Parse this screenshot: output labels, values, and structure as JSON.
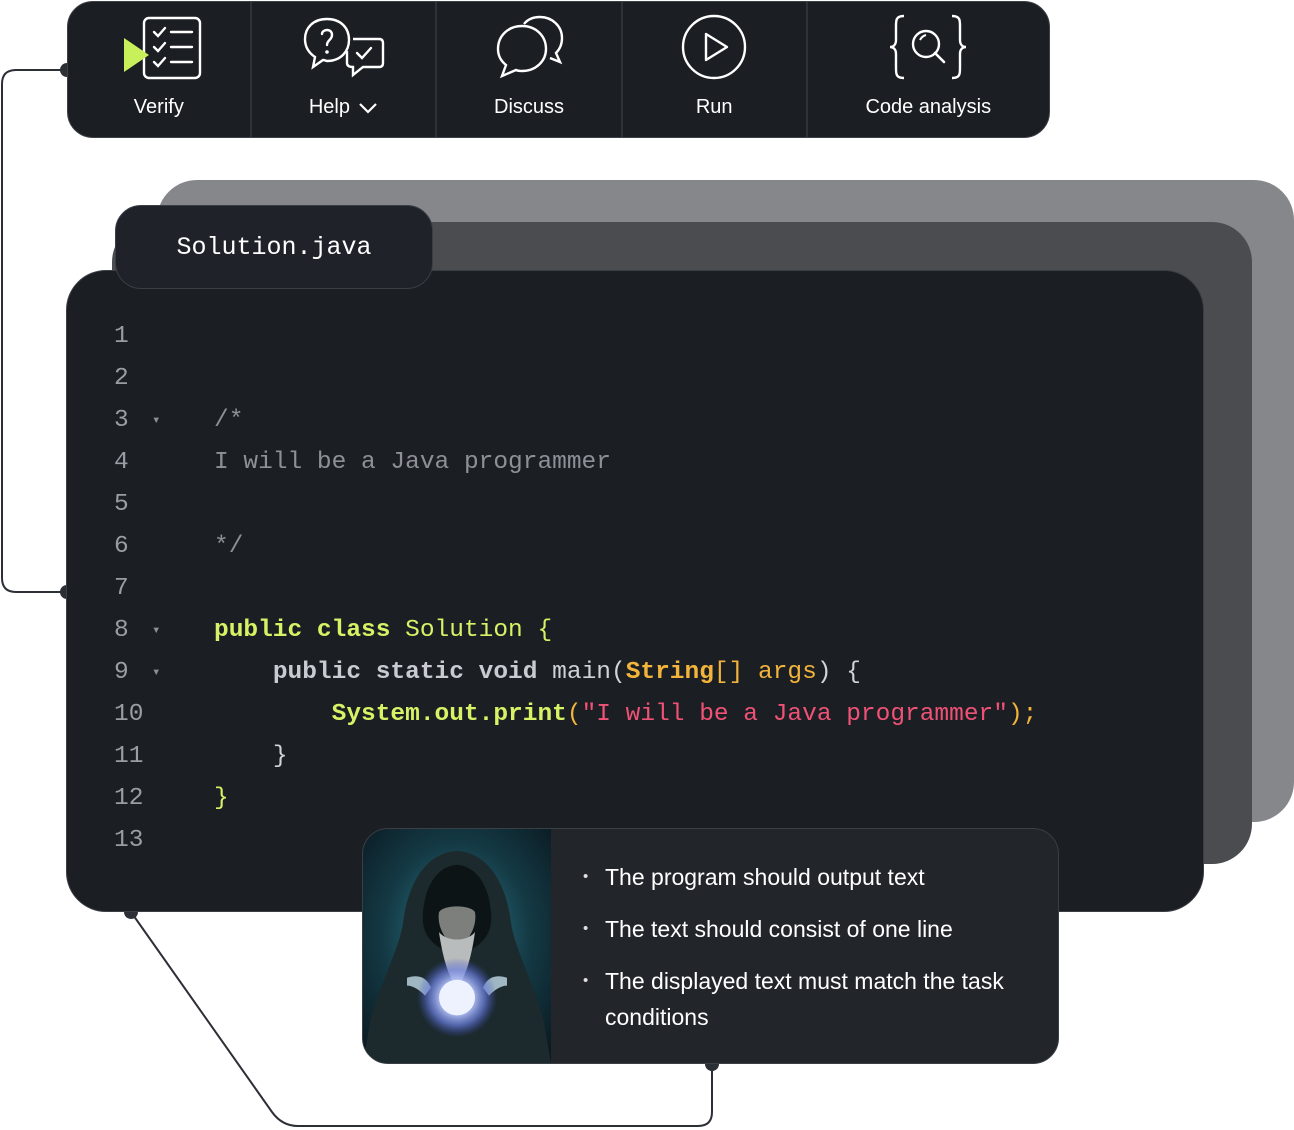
{
  "toolbar": {
    "items": [
      {
        "label": "Verify",
        "icon": "verify-checklist-icon"
      },
      {
        "label": "Help",
        "icon": "help-chat-icon",
        "has_dropdown": true
      },
      {
        "label": "Discuss",
        "icon": "discuss-bubbles-icon"
      },
      {
        "label": "Run",
        "icon": "run-play-icon"
      },
      {
        "label": "Code analysis",
        "icon": "code-analysis-icon"
      }
    ]
  },
  "editor": {
    "filename": "Solution.java",
    "line_numbers": [
      "1",
      "2",
      "3",
      "4",
      "5",
      "6",
      "7",
      "8",
      "9",
      "10",
      "11",
      "12",
      "13"
    ],
    "comment_open": "/*",
    "comment_text": "I will be a Java programmer",
    "comment_close": "*/",
    "kw_public": "public",
    "kw_class": "class",
    "class_name": "Solution",
    "brace_open": "{",
    "kw_static": "static",
    "kw_void": "void",
    "method_main": "main(",
    "type_string": "String",
    "array_brackets": "[]",
    "param_args": "args",
    "params_close": ") {",
    "print_call": "System.out.print",
    "paren_open": "(",
    "string_literal": "\"I will be a Java programmer\"",
    "stmt_end": ");",
    "brace_close": "}"
  },
  "task": {
    "conditions": [
      "The program should output text",
      "The text should consist of one line",
      "The displayed text must match the task conditions"
    ]
  },
  "colors": {
    "background": "#ffffff",
    "panel": "#1b1e23",
    "accent_green": "#d6f265",
    "string_red": "#f05276",
    "type_orange": "#f2b43b",
    "comment_gray": "#8d9096"
  }
}
